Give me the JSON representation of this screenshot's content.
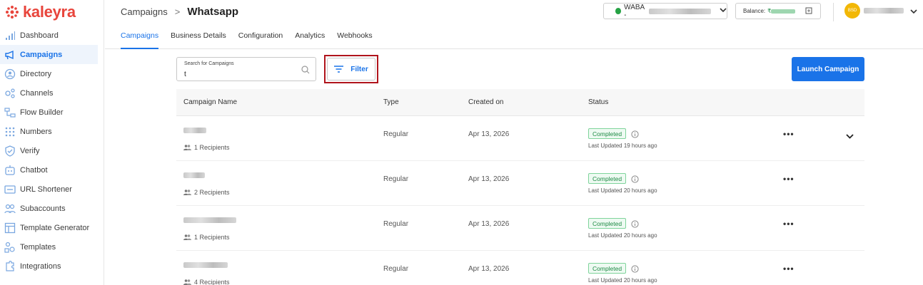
{
  "brand": {
    "name": "kaleyra",
    "accent": "#e8453c"
  },
  "sidebar": {
    "items": [
      {
        "label": "Dashboard",
        "icon": "bar-chart-icon",
        "active": false
      },
      {
        "label": "Campaigns",
        "icon": "megaphone-icon",
        "active": true
      },
      {
        "label": "Directory",
        "icon": "directory-icon",
        "active": false
      },
      {
        "label": "Channels",
        "icon": "channels-icon",
        "active": false
      },
      {
        "label": "Flow Builder",
        "icon": "flow-icon",
        "active": false
      },
      {
        "label": "Numbers",
        "icon": "dialpad-icon",
        "active": false
      },
      {
        "label": "Verify",
        "icon": "shield-icon",
        "active": false
      },
      {
        "label": "Chatbot",
        "icon": "chatbot-icon",
        "active": false
      },
      {
        "label": "URL Shortener",
        "icon": "link-icon",
        "active": false
      },
      {
        "label": "Subaccounts",
        "icon": "users-icon",
        "active": false
      },
      {
        "label": "Template Generator",
        "icon": "template-generator-icon",
        "active": false
      },
      {
        "label": "Templates",
        "icon": "templates-icon",
        "active": false
      },
      {
        "label": "Integrations",
        "icon": "puzzle-icon",
        "active": false
      }
    ]
  },
  "header": {
    "breadcrumb_parent": "Campaigns",
    "breadcrumb_sep": ">",
    "breadcrumb_current": "Whatsapp",
    "waba_prefix": "WABA -",
    "balance_label": "Balance:",
    "balance_currency": "₹",
    "avatar_text": "BSD"
  },
  "tabs": [
    {
      "label": "Campaigns",
      "active": true
    },
    {
      "label": "Business Details",
      "active": false
    },
    {
      "label": "Configuration",
      "active": false
    },
    {
      "label": "Analytics",
      "active": false
    },
    {
      "label": "Webhooks",
      "active": false
    }
  ],
  "search": {
    "label": "Search for Campaigns",
    "value": "t"
  },
  "filter_label": "Filter",
  "launch_label": "Launch Campaign",
  "table": {
    "columns": [
      "Campaign Name",
      "Type",
      "Created on",
      "Status"
    ],
    "rows": [
      {
        "recipients": "1 Recipients",
        "type": "Regular",
        "created": "Apr 13, 2026",
        "status": "Completed",
        "updated": "Last Updated 19 hours ago",
        "expandable": true
      },
      {
        "recipients": "2 Recipients",
        "type": "Regular",
        "created": "Apr 13, 2026",
        "status": "Completed",
        "updated": "Last Updated 20 hours ago",
        "expandable": false
      },
      {
        "recipients": "1 Recipients",
        "type": "Regular",
        "created": "Apr 13, 2026",
        "status": "Completed",
        "updated": "Last Updated 20 hours ago",
        "expandable": false
      },
      {
        "recipients": "4 Recipients",
        "type": "Regular",
        "created": "Apr 13, 2026",
        "status": "Completed",
        "updated": "Last Updated 20 hours ago",
        "expandable": false
      }
    ]
  },
  "colors": {
    "primary": "#1a73e8",
    "success": "#1e8a45",
    "highlight": "#b0141c"
  }
}
